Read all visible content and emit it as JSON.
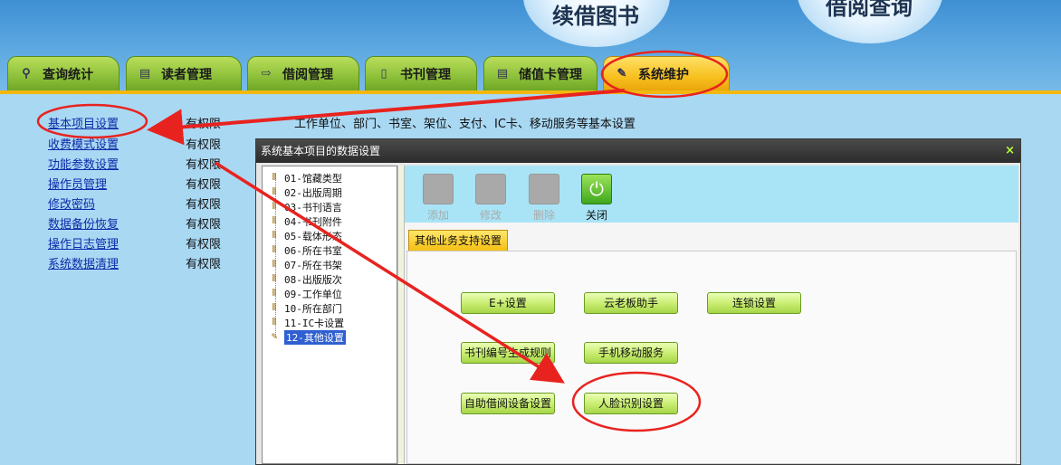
{
  "banner": {
    "button_renew": "续借图书",
    "button_query": "借阅查询"
  },
  "tabs": [
    {
      "label": "查询统计",
      "icon": "search-icon"
    },
    {
      "label": "读者管理",
      "icon": "document-icon"
    },
    {
      "label": "借阅管理",
      "icon": "arrow-right-icon"
    },
    {
      "label": "书刊管理",
      "icon": "file-icon"
    },
    {
      "label": "储值卡管理",
      "icon": "document-icon"
    },
    {
      "label": "系统维护",
      "icon": "wrench-icon"
    }
  ],
  "menu": [
    {
      "label": "基本项目设置",
      "permission": "有权限"
    },
    {
      "label": "收费模式设置",
      "permission": "有权限"
    },
    {
      "label": "功能参数设置",
      "permission": "有权限"
    },
    {
      "label": "操作员管理",
      "permission": "有权限"
    },
    {
      "label": "修改密码",
      "permission": "有权限"
    },
    {
      "label": "数据备份恢复",
      "permission": "有权限"
    },
    {
      "label": "操作日志管理",
      "permission": "有权限"
    },
    {
      "label": "系统数据清理",
      "permission": "有权限"
    }
  ],
  "menu_description": "工作单位、部门、书室、架位、支付、IC卡、移动服务等基本设置",
  "dialog": {
    "title": "系统基本项目的数据设置",
    "close": "×",
    "tree": [
      "01-馆藏类型",
      "02-出版周期",
      "03-书刊语言",
      "04-书刊附件",
      "05-载体形态",
      "06-所在书室",
      "07-所在书架",
      "08-出版版次",
      "09-工作单位",
      "10-所在部门",
      "11-IC卡设置",
      "12-其他设置"
    ],
    "toolbar": {
      "add": "添加",
      "edit": "修改",
      "delete": "删除",
      "close": "关闭"
    },
    "subtab": "其他业务支持设置",
    "buttons": {
      "e_plus": "E+设置",
      "cloud_helper": "云老板助手",
      "chain": "连锁设置",
      "numbering": "书刊编号生成规则",
      "mobile": "手机移动服务",
      "self_service": "自助借阅设备设置",
      "face": "人脸识别设置"
    }
  },
  "colors": {
    "annotation": "#e8231f",
    "tab_green": "#8cc03a",
    "tab_active": "#f7c01f",
    "link": "#0f2aa8"
  }
}
